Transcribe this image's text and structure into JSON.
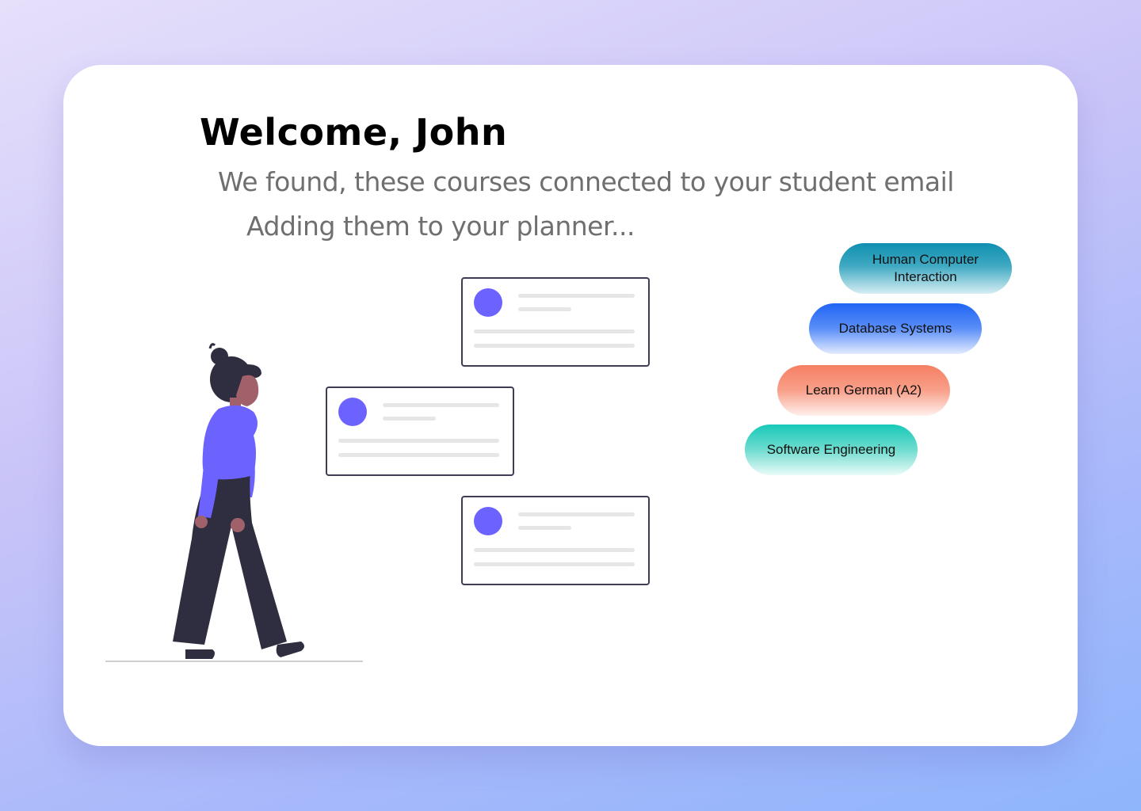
{
  "welcome": {
    "title": "Welcome, John",
    "subtitle": "We found, these courses connected to your student email",
    "status": "Adding them to your planner..."
  },
  "courses": [
    {
      "label": "Human Computer Interaction",
      "color": "#1a93b3"
    },
    {
      "label": "Database Systems",
      "color": "#2a6cf5"
    },
    {
      "label": "Learn German (A2)",
      "color": "#f58467"
    },
    {
      "label": "Software Engineering",
      "color": "#22cbbb"
    }
  ],
  "colors": {
    "accent": "#6c63ff",
    "background_top": "#e6e0fb",
    "background_bottom": "#8fb5fb",
    "card": "#ffffff",
    "figure_dark": "#2f2e41",
    "skin": "#a0616a"
  }
}
